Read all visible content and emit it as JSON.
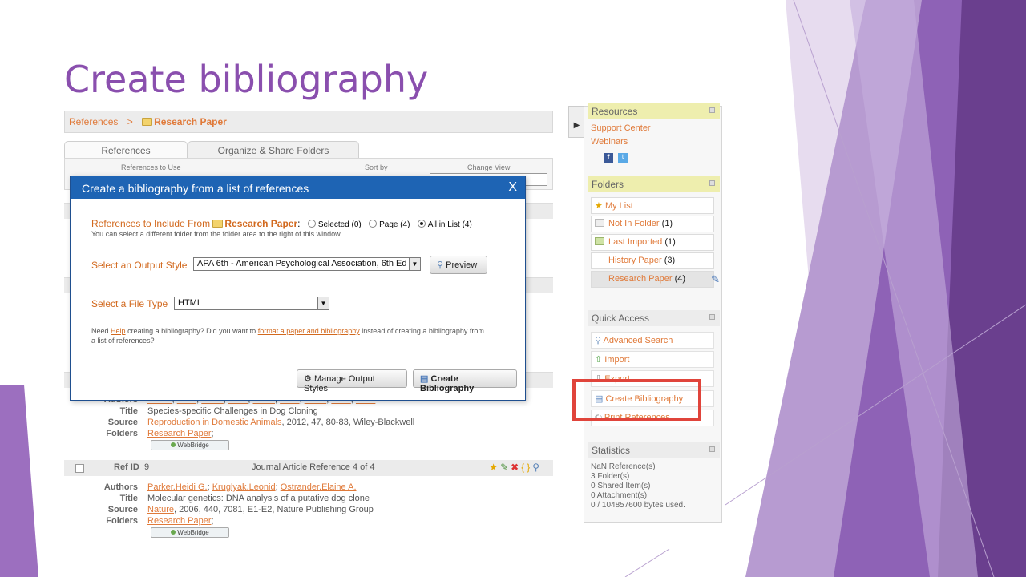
{
  "slide": {
    "title": "Create bibliography"
  },
  "breadcrumb": {
    "root": "References",
    "sep": ">",
    "folder": "Research Paper"
  },
  "tabs": [
    {
      "label": "References"
    },
    {
      "label": "Organize & Share Folders"
    }
  ],
  "toolbar": {
    "references_to_use": "References to Use",
    "sort_by": "Sort by",
    "change_view": "Change View"
  },
  "dialog": {
    "title": "Create a bibliography from a list of references",
    "close": "X",
    "include_label": "References to Include From",
    "include_folder": "Research Paper",
    "radio_selected": "Selected (0)",
    "radio_page": "Page (4)",
    "radio_all": "All in List (4)",
    "include_hint": "You can select a different folder from the folder area to the right of this window.",
    "output_style_label": "Select an Output Style",
    "output_style_value": "APA 6th - American Psychological Association, 6th Ed",
    "preview_btn": "Preview",
    "file_type_label": "Select a File Type",
    "file_type_value": "HTML",
    "help_pre": "Need",
    "help_link": "Help",
    "help_mid": "creating a bibliography? Did you want to",
    "help_link2": "format a paper and bibliography",
    "help_post": "instead of creating a bibliography from",
    "help_post2": "a list of references?",
    "manage_btn": "Manage Output Styles",
    "create_btn": "Create Bibliography"
  },
  "ref3": {
    "authors_label": "Authors",
    "title_label": "Title",
    "title": "Species-specific Challenges in Dog Cloning",
    "source_label": "Source",
    "source_link": "Reproduction in Domestic Animals",
    "source_rest": ", 2012, 47, 80-83, Wiley-Blackwell",
    "folders_label": "Folders",
    "folder": "Research Paper",
    "webbridge": "WebBridge"
  },
  "ref4_head": {
    "refid_label": "Ref ID",
    "refid": "9",
    "type": "Journal Article Reference 4 of 4"
  },
  "ref4": {
    "authors_label": "Authors",
    "author1": "Parker,Heidi G.",
    "author2": "Kruglyak,Leonid",
    "author3": "Ostrander,Elaine A.",
    "title_label": "Title",
    "title": "Molecular genetics: DNA analysis of a putative dog clone",
    "source_label": "Source",
    "source_link": "Nature",
    "source_rest": ", 2006, 440, 7081, E1-E2, Nature Publishing Group",
    "folders_label": "Folders",
    "folder": "Research Paper",
    "webbridge": "WebBridge"
  },
  "panel": {
    "resources": {
      "title": "Resources",
      "support": "Support Center",
      "webinars": "Webinars"
    },
    "folders": {
      "title": "Folders",
      "items": [
        {
          "name": "My List",
          "count": ""
        },
        {
          "name": "Not In Folder",
          "count": "(1)"
        },
        {
          "name": "Last Imported",
          "count": "(1)"
        },
        {
          "name": "History Paper",
          "count": "(3)"
        },
        {
          "name": "Research Paper",
          "count": "(4)"
        }
      ]
    },
    "quick_access": {
      "title": "Quick Access",
      "items": [
        "Advanced Search",
        "Import",
        "Export",
        "Create Bibliography",
        "Print References"
      ]
    },
    "statistics": {
      "title": "Statistics",
      "lines": [
        "NaN Reference(s)",
        "3 Folder(s)",
        "0 Shared Item(s)",
        "0 Attachment(s)",
        "0 / 104857600 bytes used."
      ]
    }
  },
  "colors": {
    "title": "#8a4fae",
    "dialog_bar": "#1e64b4",
    "link": "#e07a3a",
    "highlight": "#e0443b"
  }
}
